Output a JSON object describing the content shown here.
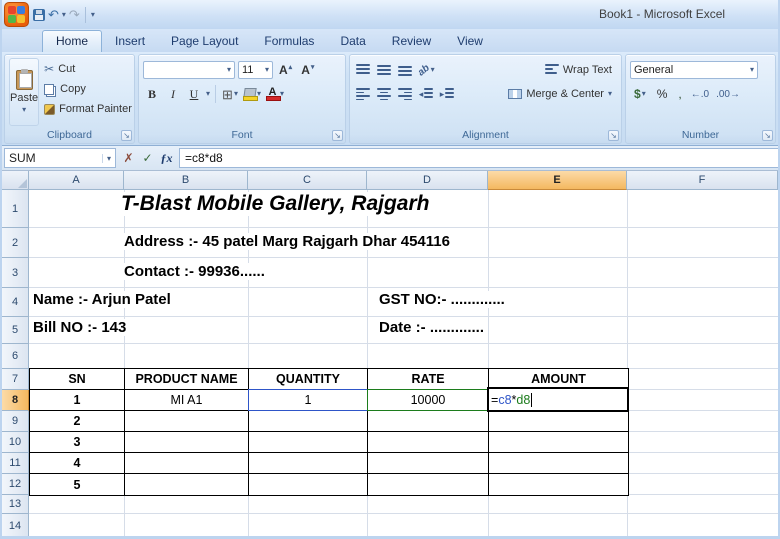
{
  "window": {
    "title": "Book1 - Microsoft Excel"
  },
  "ribbon": {
    "tabs": [
      "Home",
      "Insert",
      "Page Layout",
      "Formulas",
      "Data",
      "Review",
      "View"
    ],
    "active_tab": "Home",
    "clipboard": {
      "label": "Clipboard",
      "paste": "Paste",
      "cut": "Cut",
      "copy": "Copy",
      "format_painter": "Format Painter"
    },
    "font": {
      "label": "Font",
      "font_name": "",
      "font_size": "11",
      "bold": "B",
      "italic": "I",
      "underline": "U"
    },
    "alignment": {
      "label": "Alignment",
      "wrap_text": "Wrap Text",
      "merge_center": "Merge & Center"
    },
    "number": {
      "label": "Number",
      "format": "General",
      "currency": "$",
      "percent": "%",
      "comma": ","
    }
  },
  "icons": {
    "cut": "✂",
    "dropdown": "▾",
    "undo": "↶",
    "redo": "↷",
    "cancel": "✗",
    "enter": "✓",
    "fx": "ƒx",
    "launcher": "↘",
    "orientation": "ab",
    "grow_font": "A",
    "shrink_font": "a",
    "inc_decimal": "←.0",
    "dec_decimal": ".00→",
    "indent_left": "◂",
    "indent_right": "▸"
  },
  "formula_bar": {
    "name_box": "SUM",
    "formula": "=c8*d8"
  },
  "grid": {
    "columns": [
      "A",
      "B",
      "C",
      "D",
      "E",
      "F"
    ],
    "rows": [
      "1",
      "2",
      "3",
      "4",
      "5",
      "6",
      "7",
      "8",
      "9",
      "10",
      "11",
      "12",
      "13",
      "14"
    ],
    "active_column": "E",
    "active_row": "8",
    "active_cell": "E8"
  },
  "sheet": {
    "title": "T-Blast Mobile Gallery, Rajgarh",
    "address": "Address :- 45 patel Marg Rajgarh Dhar 454116",
    "contact": "Contact :- 99936......",
    "name_label": "Name :-  Arjun Patel",
    "gst_label": "GST NO:- .............",
    "bill_label": "Bill NO :-  143",
    "date_label": "Date :- .............",
    "table": {
      "headers": [
        "SN",
        "PRODUCT NAME",
        "QUANTITY",
        "RATE",
        "AMOUNT"
      ],
      "rows": [
        [
          "1",
          "MI A1",
          "1",
          "10000"
        ],
        [
          "2",
          "",
          "",
          ""
        ],
        [
          "3",
          "",
          "",
          ""
        ],
        [
          "4",
          "",
          "",
          ""
        ],
        [
          "5",
          "",
          "",
          ""
        ]
      ]
    },
    "formula": {
      "eq": "=",
      "ref1": "c8",
      "op": "*",
      "ref2": "d8"
    }
  },
  "colors": {
    "selection_orange": "#f4b860",
    "reference_blue": "#2e55c8",
    "reference_green": "#1c7c1c",
    "table_border": "#000000",
    "gridline": "#d6dde8"
  }
}
